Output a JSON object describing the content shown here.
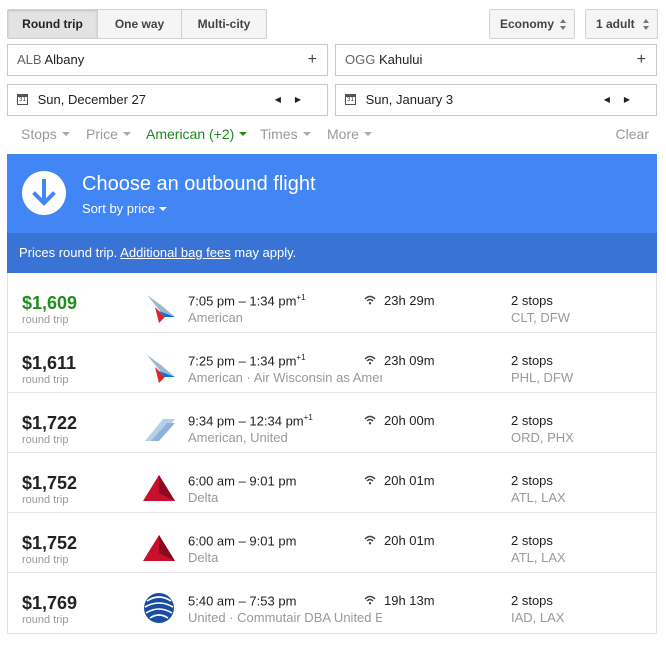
{
  "trip_type": {
    "options": [
      "Round trip",
      "One way",
      "Multi-city"
    ],
    "selected": "Round trip"
  },
  "cabin_class": "Economy",
  "passengers": "1 adult",
  "origin": {
    "code": "ALB",
    "city": "Albany"
  },
  "destination": {
    "code": "OGG",
    "city": "Kahului"
  },
  "depart_date": "Sun, December 27",
  "return_date": "Sun, January 3",
  "filters": {
    "stops": "Stops",
    "price": "Price",
    "airlines": "American (+2)",
    "times": "Times",
    "more": "More",
    "clear": "Clear"
  },
  "banner": {
    "title": "Choose an outbound flight",
    "sort": "Sort by price"
  },
  "notice": {
    "prefix": "Prices round trip.",
    "link": "Additional bag fees",
    "suffix": "may apply."
  },
  "colors": {
    "banner": "#4285f4",
    "notice": "#3a73d6",
    "best_price": "#1e8e1e",
    "active_filter": "#1e8a1e"
  },
  "flights": [
    {
      "price": "$1,609",
      "price_note": "round trip",
      "best": true,
      "logo": "american-airlines-logo",
      "times": "7:05 pm – 1:34 pm",
      "plus_days": "+1",
      "airline": "American",
      "duration": "23h 29m",
      "stops": "2 stops",
      "via": "CLT, DFW"
    },
    {
      "price": "$1,611",
      "price_note": "round trip",
      "best": false,
      "logo": "american-airlines-logo",
      "times": "7:25 pm – 1:34 pm",
      "plus_days": "+1",
      "airline": "American · Air Wisconsin as American Eagle",
      "duration": "23h 09m",
      "stops": "2 stops",
      "via": "PHL, DFW"
    },
    {
      "price": "$1,722",
      "price_note": "round trip",
      "best": false,
      "logo": "multi-airline-logo",
      "times": "9:34 pm – 12:34 pm",
      "plus_days": "+1",
      "airline": "American, United",
      "duration": "20h 00m",
      "stops": "2 stops",
      "via": "ORD, PHX"
    },
    {
      "price": "$1,752",
      "price_note": "round trip",
      "best": false,
      "logo": "delta-logo",
      "times": "6:00 am – 9:01 pm",
      "plus_days": "",
      "airline": "Delta",
      "duration": "20h 01m",
      "stops": "2 stops",
      "via": "ATL, LAX"
    },
    {
      "price": "$1,752",
      "price_note": "round trip",
      "best": false,
      "logo": "delta-logo",
      "times": "6:00 am – 9:01 pm",
      "plus_days": "",
      "airline": "Delta",
      "duration": "20h 01m",
      "stops": "2 stops",
      "via": "ATL, LAX"
    },
    {
      "price": "$1,769",
      "price_note": "round trip",
      "best": false,
      "logo": "united-logo",
      "times": "5:40 am – 7:53 pm",
      "plus_days": "",
      "airline": "United · Commutair DBA United Express",
      "duration": "19h 13m",
      "stops": "2 stops",
      "via": "IAD, LAX"
    }
  ]
}
